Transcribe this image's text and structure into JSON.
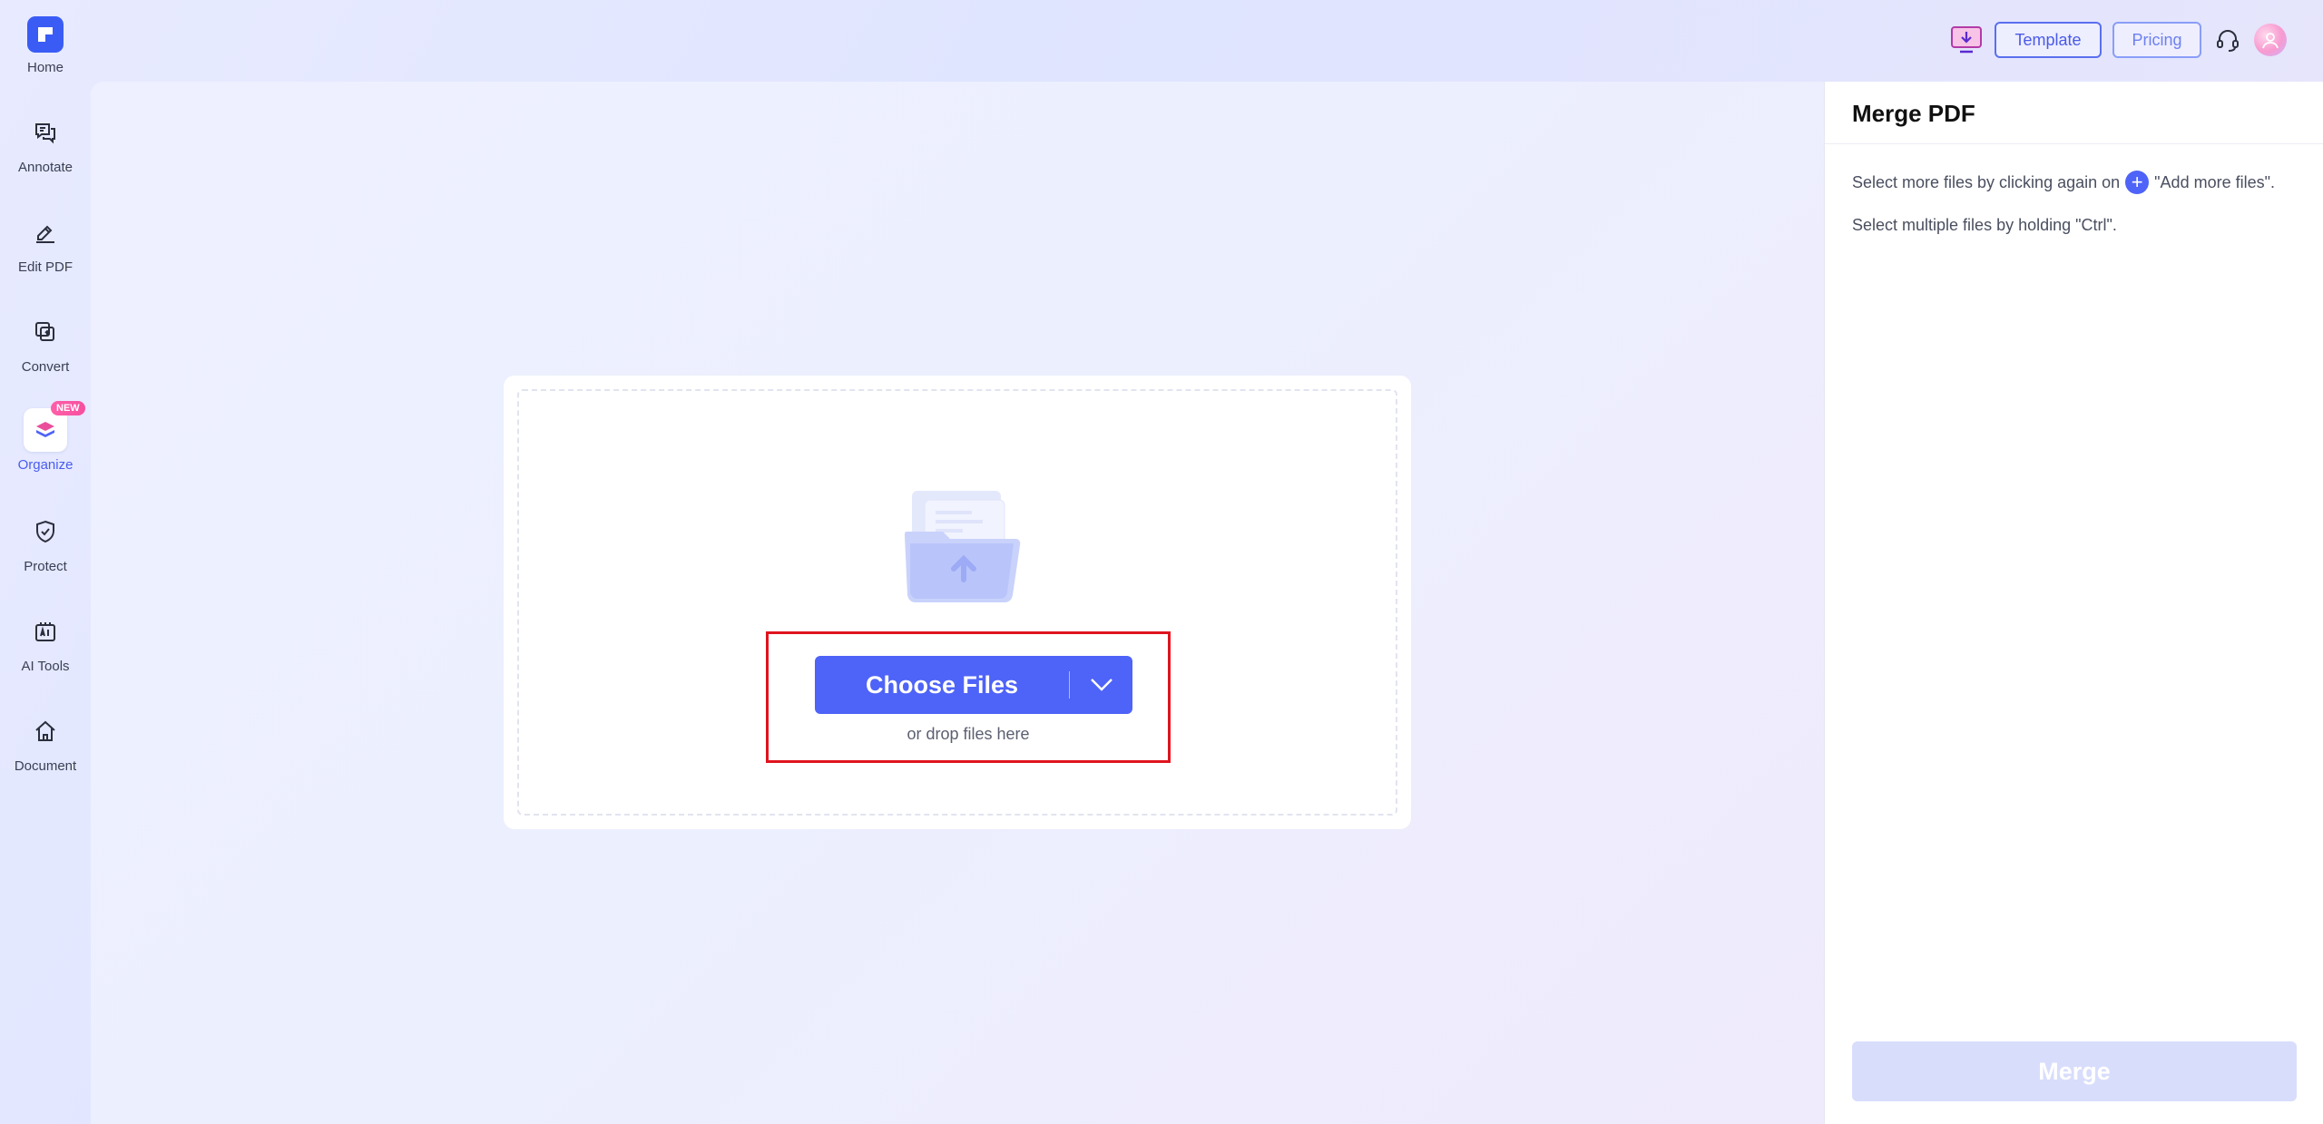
{
  "sidebar": {
    "items": [
      {
        "label": "Home",
        "icon": "app-logo-icon"
      },
      {
        "label": "Annotate",
        "icon": "annotate-icon"
      },
      {
        "label": "Edit PDF",
        "icon": "edit-pdf-icon"
      },
      {
        "label": "Convert",
        "icon": "convert-icon"
      },
      {
        "label": "Organize",
        "icon": "organize-icon",
        "active": true,
        "badge": "NEW"
      },
      {
        "label": "Protect",
        "icon": "shield-icon"
      },
      {
        "label": "AI Tools",
        "icon": "ai-tools-icon"
      },
      {
        "label": "Document",
        "icon": "house-icon"
      }
    ]
  },
  "topbar": {
    "template_label": "Template",
    "pricing_label": "Pricing"
  },
  "upload": {
    "choose_label": "Choose Files",
    "drop_hint": "or drop files here"
  },
  "panel": {
    "title": "Merge PDF",
    "line1_before": "Select more files by clicking again on",
    "line1_after": "\"Add more files\".",
    "line2": "Select multiple files by holding \"Ctrl\".",
    "merge_label": "Merge"
  },
  "colors": {
    "accent": "#4e63f7",
    "highlight": "#e0141e",
    "merge_disabled": "#d8ddfc",
    "badge": "#f74ea0"
  }
}
